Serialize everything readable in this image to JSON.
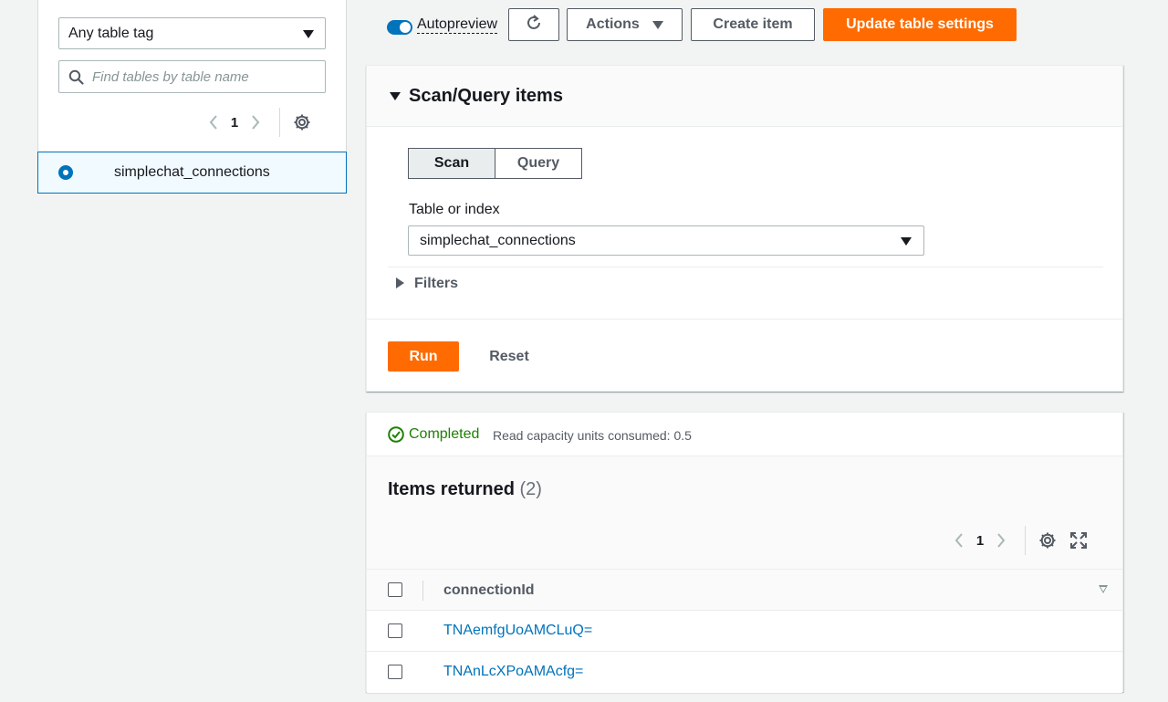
{
  "left": {
    "tag_filter": {
      "value": "Any table tag"
    },
    "search": {
      "placeholder": "Find tables by table name",
      "value": ""
    },
    "pagination": {
      "current_page": "1"
    },
    "tables": [
      {
        "name": "simplechat_connections",
        "selected": true
      }
    ]
  },
  "toolbar": {
    "autopreview_label": "Autopreview",
    "autopreview_on": true,
    "refresh_icon": "refresh-icon",
    "actions_label": "Actions",
    "create_item_label": "Create item",
    "update_settings_label": "Update table settings"
  },
  "scan_panel": {
    "title": "Scan/Query items",
    "tabs": [
      "Scan",
      "Query"
    ],
    "active_tab": "Scan",
    "table_or_index_label": "Table or index",
    "table_or_index_value": "simplechat_connections",
    "filters_label": "Filters",
    "run_label": "Run",
    "reset_label": "Reset"
  },
  "results": {
    "status": "Completed",
    "rcu_text": "Read capacity units consumed: 0.5",
    "items_title": "Items returned",
    "items_count": "(2)",
    "pagination": {
      "current_page": "1"
    },
    "column_header": "connectionId",
    "rows": [
      {
        "connectionId": "TNAemfgUoAMCLuQ="
      },
      {
        "connectionId": "TNAnLcXPoAMAcfg="
      }
    ]
  },
  "colors": {
    "primary_orange": "#ff6b00",
    "link_blue": "#0073bb",
    "success_green": "#1d8102"
  }
}
